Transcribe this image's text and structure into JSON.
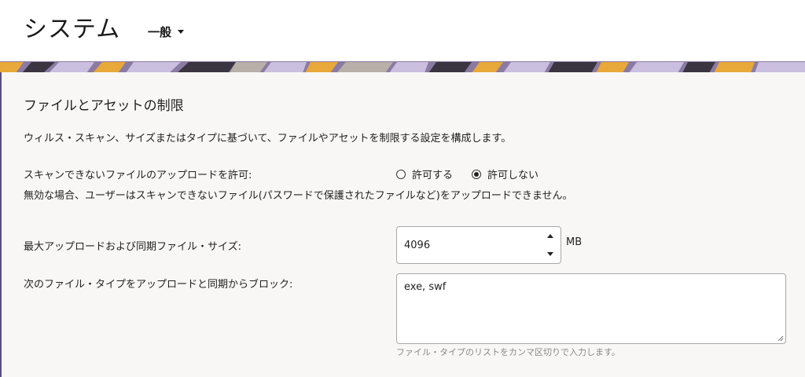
{
  "header": {
    "title": "システム",
    "section_dropdown": "一般"
  },
  "section": {
    "title": "ファイルとアセットの制限",
    "description": "ウィルス・スキャン、サイズまたはタイプに基づいて、ファイルやアセットを制限する設定を構成します。"
  },
  "unscannable": {
    "label": "スキャンできないファイルのアップロードを許可:",
    "options": [
      {
        "label": "許可する",
        "selected": false
      },
      {
        "label": "許可しない",
        "selected": true
      }
    ],
    "note": "無効な場合、ユーザーはスキャンできないファイル(パスワードで保護されたファイルなど)をアップロードできません。"
  },
  "max_size": {
    "label": "最大アップロードおよび同期ファイル・サイズ:",
    "value": "4096",
    "unit": "MB"
  },
  "blocked_types": {
    "label": "次のファイル・タイプをアップロードと同期からブロック:",
    "value": "exe, swf",
    "helper": "ファイル・タイプのリストをカンマ区切りで入力します。"
  },
  "colors": {
    "banner_purple": "#8b7ba3",
    "banner_lavender": "#cbbfe0",
    "banner_orange": "#e8a83a",
    "banner_dark": "#3a3540",
    "content_bg": "#f8f7f5"
  }
}
